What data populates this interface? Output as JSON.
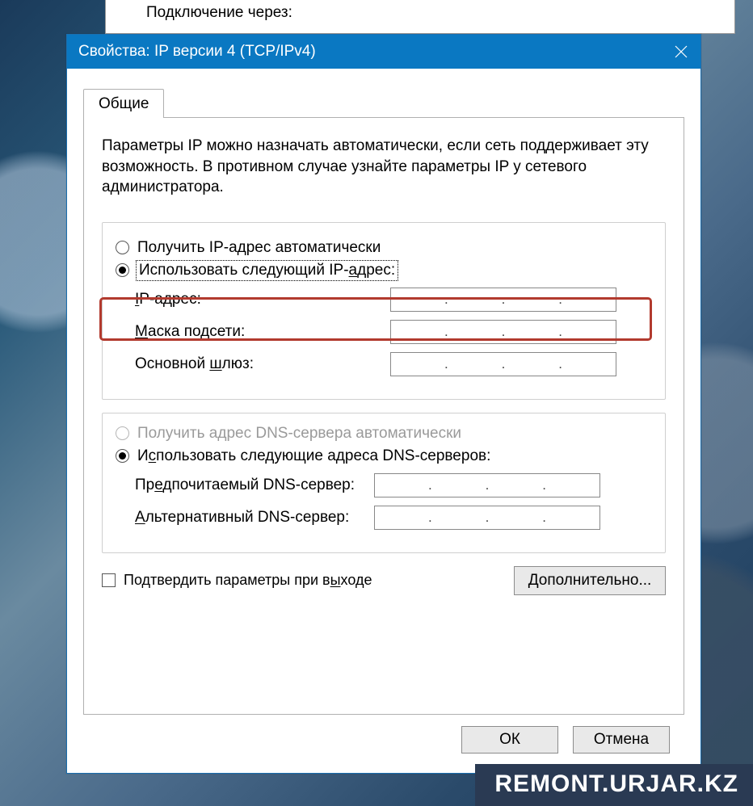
{
  "parent_window": {
    "connect_via_label": "Подключение через:"
  },
  "dialog": {
    "title": "Свойства: IP версии 4 (TCP/IPv4)",
    "tab_label": "Общие",
    "info_text": "Параметры IP можно назначать автоматически, если сеть поддерживает эту возможность. В противном случае узнайте параметры IP у сетевого администратора.",
    "ip_group": {
      "radio_auto": "Получить IP-адрес автоматически",
      "radio_auto_ul": "П",
      "radio_manual_before": "Использовать следующий IP-",
      "radio_manual_ul": "а",
      "radio_manual_after": "дрес:",
      "checked": "manual",
      "ip_label_ul": "I",
      "ip_label_rest": "P-адрес:",
      "mask_label_ul": "М",
      "mask_label_rest": "аска подсети:",
      "gw_label_before": "Основной ",
      "gw_label_ul": "ш",
      "gw_label_after": "люз:",
      "ip_value": "",
      "mask_value": "",
      "gw_value": ""
    },
    "dns_group": {
      "radio_auto": "Получить адрес DNS-сервера автоматически",
      "radio_manual_before": "И",
      "radio_manual_ul": "с",
      "radio_manual_after": "пользовать следующие адреса DNS-серверов:",
      "checked": "manual",
      "pref_before": "Пр",
      "pref_ul": "е",
      "pref_after": "дпочитаемый DNS-сервер:",
      "alt_ul": "А",
      "alt_rest": "льтернативный DNS-сервер:",
      "pref_value": "",
      "alt_value": ""
    },
    "confirm_before": "Подтвердить параметры при в",
    "confirm_ul": "ы",
    "confirm_after": "ходе",
    "confirm_checked": false,
    "advanced_ul": "Д",
    "advanced_rest": "ополнительно...",
    "ok": "ОК",
    "cancel": "Отмена"
  },
  "watermark": "REMONT.URJAR.KZ"
}
